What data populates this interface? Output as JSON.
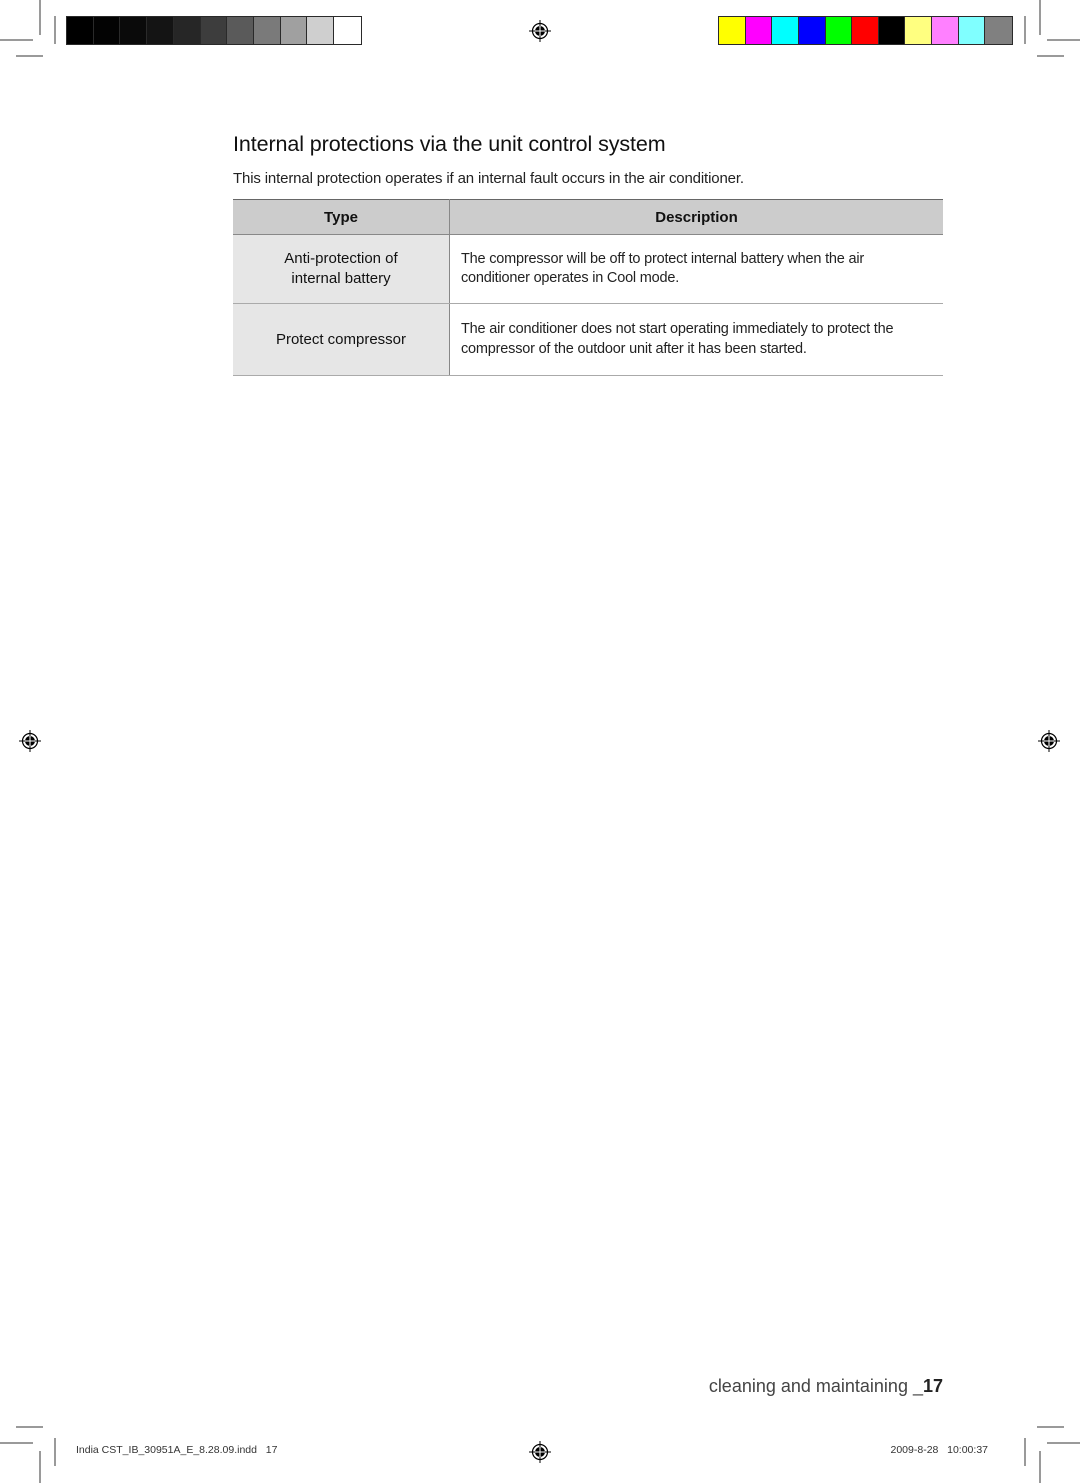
{
  "color_bars": {
    "grayscale": [
      "#000000",
      "#030303",
      "#0a0a0a",
      "#141414",
      "#262626",
      "#3d3d3d",
      "#5a5a5a",
      "#7a7a7a",
      "#a0a0a0",
      "#cfcfcf",
      "#ffffff"
    ],
    "process": [
      "#ffff00",
      "#ff00ff",
      "#00ffff",
      "#0000ff",
      "#00ff00",
      "#ff0000",
      "#000000",
      "#ffff80",
      "#ff80ff",
      "#80ffff",
      "#808080"
    ]
  },
  "section": {
    "title": "Internal protections via the unit control system",
    "intro": "This internal protection operates if an internal fault occurs in the air conditioner."
  },
  "table": {
    "headers": {
      "type": "Type",
      "description": "Description"
    },
    "rows": [
      {
        "type_line1": "Anti-protection of",
        "type_line2": "internal battery",
        "description_line1": "The compressor will be off to protect internal battery when the air",
        "description_line2": "conditioner operates in Cool mode."
      },
      {
        "type_line1": "Protect compressor",
        "type_line2": "",
        "description_line1": "The air conditioner does not start operating immediately to protect the",
        "description_line2": "compressor of the outdoor unit after it has been started."
      }
    ]
  },
  "footer": {
    "section_label": "cleaning and maintaining _",
    "page_number": "17",
    "slug_file": "India CST_IB_30951A_E_8.28.09.indd   17",
    "slug_datetime": "2009-8-28   10:00:37"
  }
}
